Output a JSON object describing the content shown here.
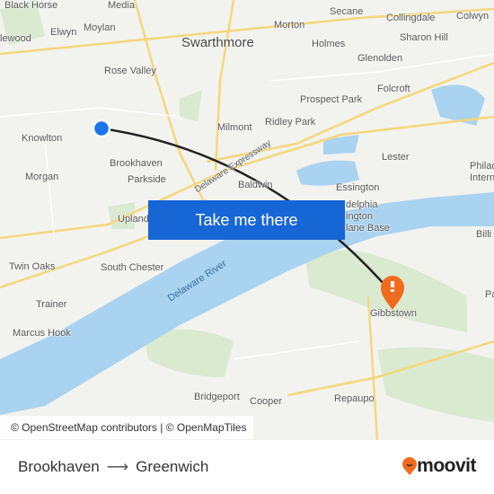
{
  "map": {
    "labels": {
      "black_horse": "Black Horse",
      "media": "Media",
      "elwyn": "Elwyn",
      "moylan": "Moylan",
      "swarthmore": "Swarthmore",
      "morton": "Morton",
      "secane": "Secane",
      "collingdale": "Collingdale",
      "colwyn": "Colwyn",
      "holmes": "Holmes",
      "sharon_hill": "Sharon Hill",
      "rose_valley": "Rose Valley",
      "glenolden": "Glenolden",
      "prospect_park": "Prospect Park",
      "folcroft": "Folcroft",
      "milmont": "Milmont",
      "ridley_park": "Ridley Park",
      "knowlton": "Knowlton",
      "brookhaven": "Brookhaven",
      "parkside": "Parkside",
      "morgan": "Morgan",
      "baldwin": "Baldwin",
      "lester": "Lester",
      "essington": "Essington",
      "philadelphia_intl": "Philad\nInternatio",
      "upland": "Upland",
      "twin_oaks": "Twin Oaks",
      "south_chester": "South Chester",
      "trainer": "Trainer",
      "marcus_hook": "Marcus Hook",
      "delaware_river": "Delaware River",
      "delaware_expressway": "Delaware Expressway",
      "phila_seaplane": "delphia\nington\nlane Base",
      "gibbstown": "Gibbstown",
      "bridgeport": "Bridgeport",
      "cooper": "Cooper",
      "repaupo": "Repaupo",
      "billingsport": "Billi",
      "paulsboro": "Pa",
      "edgewood": "lewood",
      "prospect": "Prospect"
    },
    "origin_marker_color": "#1a73e8",
    "destination_marker_color": "#f26b1d",
    "route_color": "#222222",
    "cta_label": "Take me there",
    "attribution": "© OpenStreetMap contributors | © OpenMapTiles"
  },
  "footer": {
    "from": "Brookhaven",
    "arrow": "⟶",
    "to": "Greenwich",
    "brand": "moovit",
    "brand_color": "#f26b1d"
  }
}
